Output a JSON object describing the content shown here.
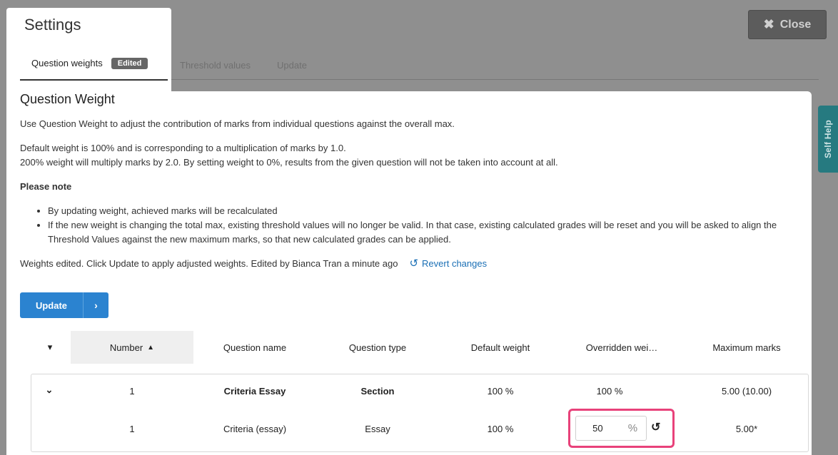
{
  "settings": {
    "title": "Settings"
  },
  "tabs": [
    {
      "label": "Question weights",
      "badge": "Edited"
    },
    {
      "label": "Threshold values"
    },
    {
      "label": "Update"
    }
  ],
  "close": {
    "label": "Close",
    "icon": "close-icon"
  },
  "self_help": {
    "label": "Self Help"
  },
  "content": {
    "heading": "Question Weight",
    "intro": "Use Question Weight to adjust the contribution of marks from individual questions against the overall max.",
    "default_line1": "Default weight is 100% and is corresponding to a multiplication of marks by 1.0.",
    "default_line2": "200% weight will multiply marks by 2.0. By setting weight to 0%, results from the given question will not be taken into account at all.",
    "please_note": "Please note",
    "notes": [
      "By updating weight, achieved marks will be recalculated",
      "If the new weight is changing the total max, existing threshold values will no longer be valid. In that case, existing calculated grades will be reset and you will be asked to align the Threshold Values against the new maximum marks, so that new calculated grades can be applied."
    ],
    "edited_status": "Weights edited. Click Update to apply adjusted weights. Edited by Bianca Tran a minute ago",
    "revert_label": "Revert changes",
    "update_label": "Update"
  },
  "table": {
    "columns": [
      "Number",
      "Question name",
      "Question type",
      "Default weight",
      "Overridden wei…",
      "Maximum marks"
    ],
    "section_row": {
      "number": "1",
      "name": "Criteria Essay",
      "type": "Section",
      "default_weight": "100 %",
      "overridden_weight": "100 %",
      "max_marks": "5.00 (10.00)"
    },
    "question_row": {
      "number": "1",
      "name": "Criteria (essay)",
      "type": "Essay",
      "default_weight": "100 %",
      "overridden_weight_value": "50",
      "overridden_unit": "%",
      "max_marks": "5.00*"
    }
  },
  "colors": {
    "accent": "#2b83d0",
    "highlight": "#e8427a",
    "self_help": "#267a80"
  }
}
